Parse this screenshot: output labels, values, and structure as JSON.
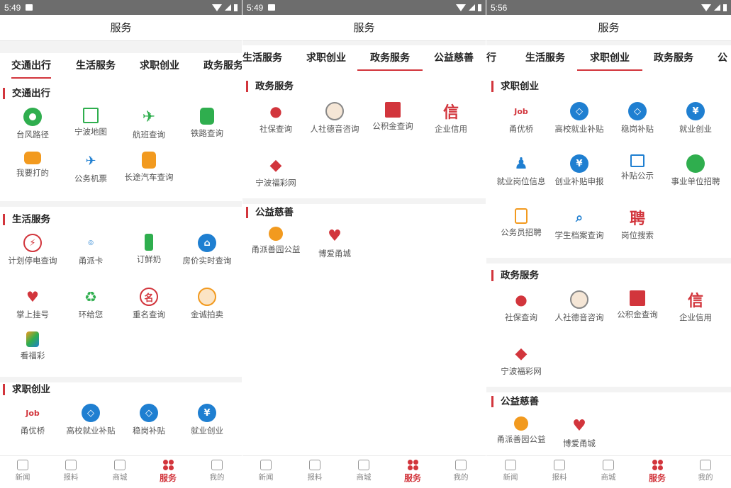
{
  "status": {
    "panel1_time": "5:49",
    "panel2_time": "5:49",
    "panel3_time": "5:56"
  },
  "header_title": "服务",
  "tabs": {
    "panel1": [
      "交通出行",
      "生活服务",
      "求职创业",
      "政务服务"
    ],
    "panel2": [
      "生活服务",
      "求职创业",
      "政务服务",
      "公益慈善"
    ],
    "panel3": [
      "行",
      "生活服务",
      "求职创业",
      "政务服务",
      "公"
    ]
  },
  "active_tab": {
    "panel1": "交通出行",
    "panel2": "政务服务",
    "panel3": "求职创业"
  },
  "sections": {
    "traffic": {
      "title": "交通出行",
      "items": [
        "台风路径",
        "宁波地图",
        "航班查询",
        "铁路查询",
        "我要打的",
        "公务机票",
        "长途汽车查询"
      ]
    },
    "life": {
      "title": "生活服务",
      "items": [
        "计划停电查询",
        "甬派卡",
        "订鲜奶",
        "房价实时查询",
        "掌上挂号",
        "环给您",
        "重名查询",
        "金诚拍卖",
        "看福彩"
      ]
    },
    "jobs": {
      "title": "求职创业",
      "items": [
        "甬优桥",
        "高校就业补贴",
        "稳岗补贴",
        "就业创业",
        "就业岗位信息",
        "创业补贴申报",
        "补贴公示",
        "事业单位招聘",
        "公务员招聘",
        "学生档案查询",
        "岗位搜索"
      ]
    },
    "gov": {
      "title": "政务服务",
      "items": [
        "社保查询",
        "人社德音咨询",
        "公积金查询",
        "企业信用",
        "宁波福彩网"
      ]
    },
    "charity": {
      "title": "公益慈善",
      "items": [
        "甬派善园公益",
        "博爱甬城"
      ]
    }
  },
  "icon_glyphs": {
    "job_logo": "Job",
    "yuan": "¥",
    "pin": "聘",
    "credit": "信"
  },
  "bottom_nav": [
    "新闻",
    "报料",
    "商城",
    "服务",
    "我的"
  ],
  "colors": {
    "accent": "#d2353c",
    "green": "#2fae4e",
    "blue": "#1f7fd1",
    "orange": "#f29a1f"
  }
}
